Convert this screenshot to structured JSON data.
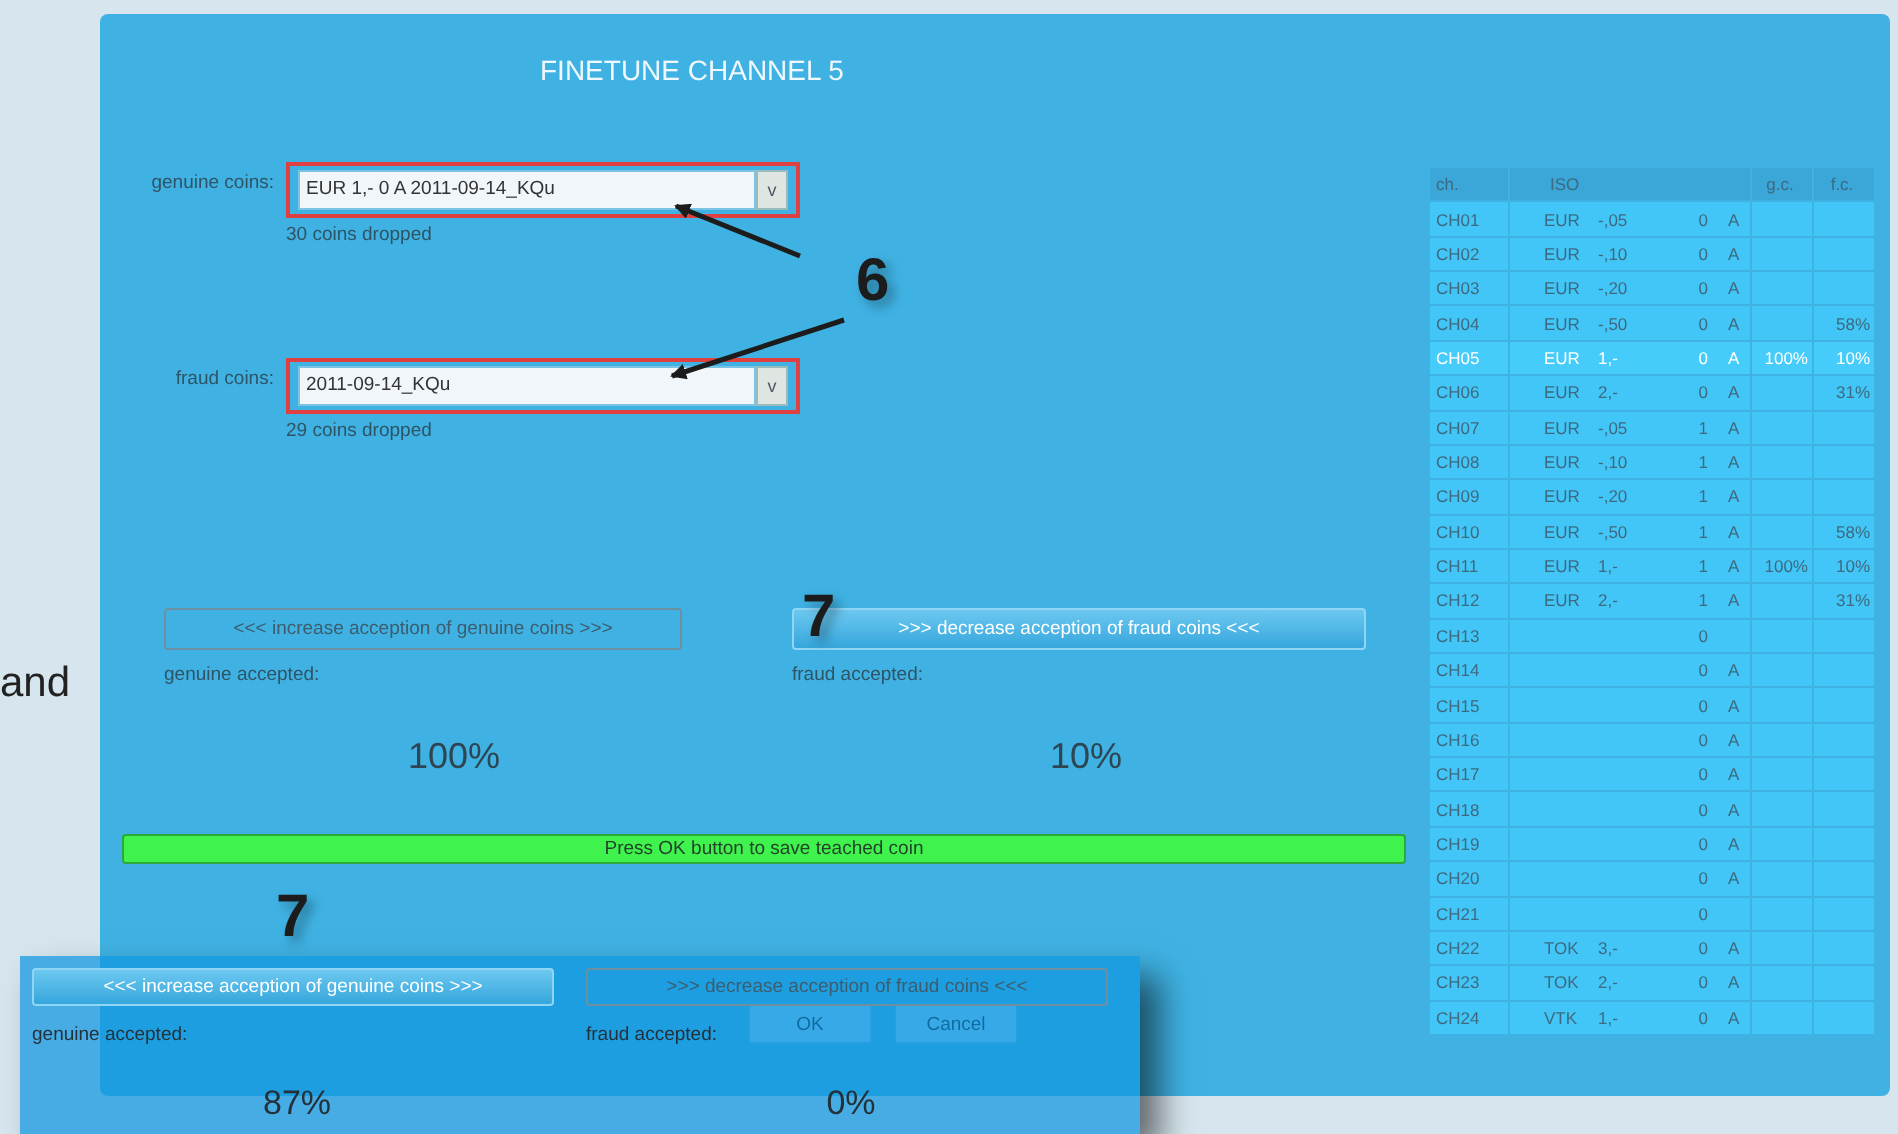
{
  "page_fragment": {
    "text": "and"
  },
  "dialog": {
    "title": "FINETUNE CHANNEL 5",
    "coin_fields": [
      {
        "label": "genuine coins:",
        "value": "EUR 1,- 0 A 2011-09-14_KQu",
        "dropdown": "v",
        "note": "30 coins dropped",
        "highlighted": true
      },
      {
        "label": "fraud coins:",
        "value": "2011-09-14_KQu",
        "dropdown": "v",
        "note": "29 coins dropped",
        "highlighted": true
      }
    ],
    "adjusters": [
      {
        "button": "<<< increase acception of genuine coins >>>",
        "disabled": true,
        "label": "genuine accepted:",
        "percent": "100%"
      },
      {
        "button": ">>>  decrease acception of fraud coins  <<<",
        "disabled": false,
        "label": "fraud accepted:",
        "percent": "10%"
      }
    ],
    "status_bar": {
      "text": "Press OK button to save teached coin"
    },
    "buttons": [
      {
        "label": "OK"
      },
      {
        "label": "Cancel"
      }
    ],
    "table": {
      "columns": [
        "ch.",
        "ISO",
        "g.c.",
        "f.c."
      ],
      "rows": [
        {
          "ch": "CH01",
          "iso": "EUR",
          "value": "-,05",
          "set": "0",
          "mode": "A",
          "selected": false
        },
        {
          "ch": "CH02",
          "iso": "EUR",
          "value": "-,10",
          "set": "0",
          "mode": "A",
          "selected": false
        },
        {
          "ch": "CH03",
          "iso": "EUR",
          "value": "-,20",
          "set": "0",
          "mode": "A",
          "selected": false
        },
        {
          "ch": "CH04",
          "iso": "EUR",
          "value": "-,50",
          "set": "0",
          "mode": "A",
          "fc": "58%",
          "selected": false
        },
        {
          "ch": "CH05",
          "iso": "EUR",
          "value": "1,-",
          "set": "0",
          "mode": "A",
          "gc": "100%",
          "fc": "10%",
          "selected": true
        },
        {
          "ch": "CH06",
          "iso": "EUR",
          "value": "2,-",
          "set": "0",
          "mode": "A",
          "fc": "31%",
          "selected": false
        },
        {
          "ch": "CH07",
          "iso": "EUR",
          "value": "-,05",
          "set": "1",
          "mode": "A",
          "selected": false
        },
        {
          "ch": "CH08",
          "iso": "EUR",
          "value": "-,10",
          "set": "1",
          "mode": "A",
          "selected": false
        },
        {
          "ch": "CH09",
          "iso": "EUR",
          "value": "-,20",
          "set": "1",
          "mode": "A",
          "selected": false
        },
        {
          "ch": "CH10",
          "iso": "EUR",
          "value": "-,50",
          "set": "1",
          "mode": "A",
          "fc": "58%",
          "selected": false
        },
        {
          "ch": "CH11",
          "iso": "EUR",
          "value": "1,-",
          "set": "1",
          "mode": "A",
          "gc": "100%",
          "fc": "10%",
          "selected": false
        },
        {
          "ch": "CH12",
          "iso": "EUR",
          "value": "2,-",
          "set": "1",
          "mode": "A",
          "fc": "31%",
          "selected": false
        },
        {
          "ch": "CH13",
          "set": "0",
          "selected": false
        },
        {
          "ch": "CH14",
          "set": "0",
          "mode": "A",
          "selected": false
        },
        {
          "ch": "CH15",
          "set": "0",
          "mode": "A",
          "selected": false
        },
        {
          "ch": "CH16",
          "set": "0",
          "mode": "A",
          "selected": false
        },
        {
          "ch": "CH17",
          "set": "0",
          "mode": "A",
          "selected": false
        },
        {
          "ch": "CH18",
          "set": "0",
          "mode": "A",
          "selected": false
        },
        {
          "ch": "CH19",
          "set": "0",
          "mode": "A",
          "selected": false
        },
        {
          "ch": "CH20",
          "set": "0",
          "mode": "A",
          "selected": false
        },
        {
          "ch": "CH21",
          "set": "0",
          "selected": false
        },
        {
          "ch": "CH22",
          "iso": "TOK",
          "value": "3,-",
          "set": "0",
          "mode": "A",
          "selected": false
        },
        {
          "ch": "CH23",
          "iso": "TOK",
          "value": "2,-",
          "set": "0",
          "mode": "A",
          "selected": false
        },
        {
          "ch": "CH24",
          "iso": "VTK",
          "value": "1,-",
          "set": "0",
          "mode": "A",
          "selected": false
        }
      ]
    }
  },
  "overlay_panel": {
    "adjusters": [
      {
        "button": "<<< increase acception of genuine coins >>>",
        "disabled": false,
        "label": "genuine accepted:",
        "percent": "87%"
      },
      {
        "button": ">>>  decrease acception of fraud coins  <<<",
        "disabled": true,
        "label": "fraud accepted:",
        "percent": "0%"
      }
    ]
  },
  "annotations": [
    {
      "label": "6"
    },
    {
      "label": "7"
    },
    {
      "label": "7"
    }
  ]
}
